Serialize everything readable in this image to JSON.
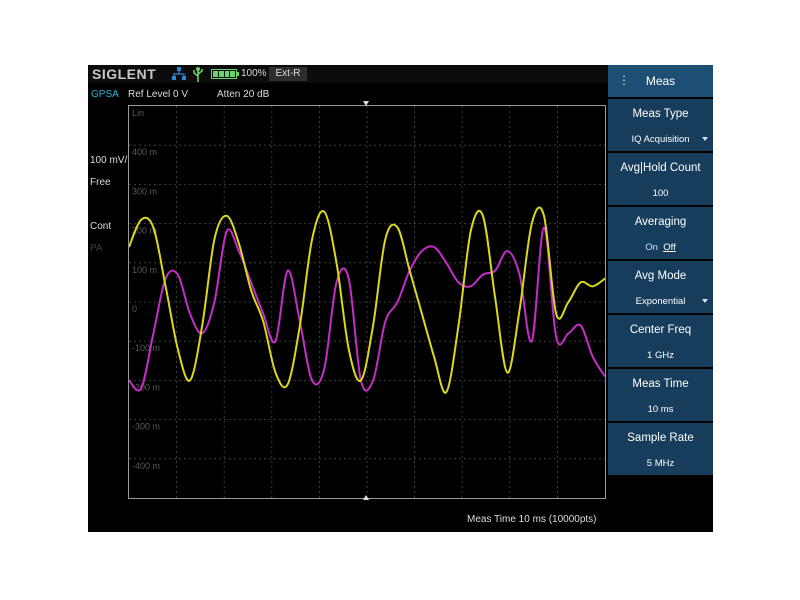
{
  "status_bar": {
    "brand": "SIGLENT",
    "battery": "100%",
    "reference": "Ext-R"
  },
  "info_bar": {
    "mode": "GPSA",
    "ref_level": "Ref Level  0 V",
    "attenuation": "Atten  20 dB"
  },
  "left_panel": {
    "scale": "100 mV/",
    "trigger": "Free",
    "sweep": "Cont",
    "pa": "PA"
  },
  "y_axis": {
    "labels": [
      "Lin",
      "400 m",
      "300 m",
      "200 m",
      "100 m",
      "0",
      "-100 m",
      "-200 m",
      "-300 m",
      "-400 m"
    ]
  },
  "footer": {
    "meas_status": "Meas Time  10 ms (10000pts)"
  },
  "menu": {
    "title": "Meas",
    "items": [
      {
        "label": "Meas Type",
        "value": "IQ Acquisition",
        "has_dropdown": true
      },
      {
        "label": "Avg|Hold Count",
        "value": "100"
      },
      {
        "label": "Averaging",
        "on": "On",
        "off": "Off",
        "selected": "Off"
      },
      {
        "label": "Avg Mode",
        "value": "Exponential",
        "has_dropdown": true
      },
      {
        "label": "Center Freq",
        "value": "1 GHz"
      },
      {
        "label": "Meas Time",
        "value": "10 ms"
      },
      {
        "label": "Sample Rate",
        "value": "5 MHz"
      }
    ]
  },
  "colors": {
    "i_trace": "#d8d81c",
    "q_trace": "#c62cc6",
    "menu_bg": "#163d5c",
    "menu_title_bg": "#1d4f75",
    "mode_text": "#29b8d8"
  },
  "traces": {
    "y_range_mV": [
      -500,
      500
    ],
    "i_samples_mV": [
      140,
      210,
      190,
      40,
      -120,
      -200,
      -60,
      160,
      220,
      150,
      30,
      -50,
      -180,
      -210,
      -60,
      160,
      230,
      100,
      -120,
      -200,
      -60,
      160,
      190,
      80,
      -30,
      -140,
      -230,
      -60,
      180,
      220,
      10,
      -180,
      -20,
      200,
      220,
      -30,
      0,
      50,
      40,
      60
    ],
    "q_samples_mV": [
      -200,
      -220,
      -80,
      60,
      70,
      -30,
      -80,
      0,
      180,
      130,
      50,
      -30,
      -100,
      80,
      -50,
      -200,
      -170,
      50,
      60,
      -200,
      -200,
      -50,
      0,
      80,
      130,
      140,
      100,
      50,
      40,
      70,
      80,
      130,
      70,
      -100,
      190,
      -90,
      -80,
      -60,
      -140,
      -190
    ]
  }
}
